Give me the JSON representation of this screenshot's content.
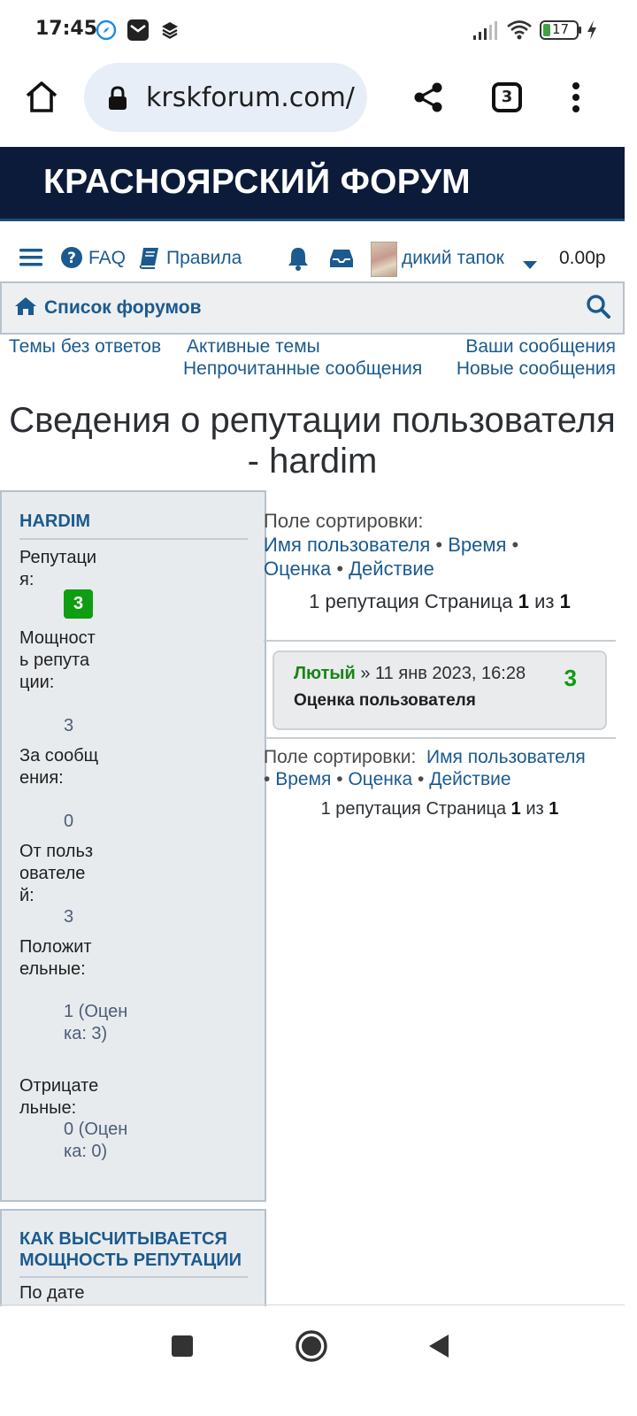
{
  "status_bar": {
    "time": "17:45",
    "battery": "17"
  },
  "browser": {
    "url": "krskforum.com/app.php/reputation/hardim",
    "tab_count": "3"
  },
  "forum": {
    "title": "КРАСНОЯРСКИЙ ФОРУМ"
  },
  "nav": {
    "faq": "FAQ",
    "rules": "Правила",
    "username": "дикий тапок",
    "balance": "0.00р"
  },
  "breadcrumb": {
    "forums": "Список форумов"
  },
  "quick_links": {
    "unanswered": "Темы без ответов",
    "active": "Активные темы",
    "your_posts": "Ваши сообщения",
    "unread": "Непрочитанные сообщения",
    "new": "Новые сообщения"
  },
  "page": {
    "heading_line1": "Сведения о репутации пользователя",
    "heading_line2": "- hardim"
  },
  "profile_panel": {
    "username": "HARDIM",
    "reputation_label": "Репутация:",
    "reputation_value": "3",
    "power_label": "Мощность репутации:",
    "power_value": "3",
    "for_posts_label": "За сообщения:",
    "for_posts_value": "0",
    "from_users_label": "От пользователей:",
    "from_users_value": "3",
    "positive_label": "Положительные:",
    "positive_value": "1 (Оценка: 3)",
    "negative_label": "Отрицательные:",
    "negative_value": "0 (Оценка: 0)"
  },
  "power_panel": {
    "title": "КАК ВЫСЧИТЫВАЕТСЯ МОЩНОСТЬ РЕПУТАЦИИ",
    "first_line": "По дате"
  },
  "sort": {
    "label": "Поле сортировки:",
    "by_username": "Имя пользователя",
    "by_time": "Время",
    "by_rating": "Оценка",
    "by_action": "Действие",
    "separator": "•"
  },
  "pagination": {
    "count_text": "1 репутация Страница",
    "current_page": "1",
    "of_text": "из",
    "total_pages": "1"
  },
  "reputation_entries": [
    {
      "from_user": "Лютый",
      "datetime": "» 11 янв 2023, 16:28",
      "action": "Оценка пользователя",
      "points": "3"
    }
  ],
  "colors": {
    "header_bg": "#0c1b39",
    "link": "#1b5a8e",
    "positive_green": "#0f9e12",
    "panel_bg": "#e8ebee"
  },
  "icons": [
    "home-icon",
    "lock-icon",
    "share-icon",
    "tabs-icon",
    "more-icon",
    "menu-icon",
    "help-icon",
    "book-icon",
    "bell-icon",
    "inbox-icon",
    "caret-down-icon",
    "house-icon",
    "search-icon",
    "stop-icon",
    "home-circle-icon",
    "back-icon"
  ]
}
